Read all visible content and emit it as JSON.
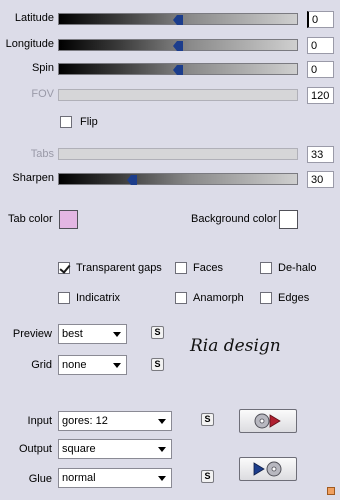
{
  "sliders": {
    "latitude": {
      "label": "Latitude",
      "value": "0",
      "position": 0.5
    },
    "longitude": {
      "label": "Longitude",
      "value": "0",
      "position": 0.5
    },
    "spin": {
      "label": "Spin",
      "value": "0",
      "position": 0.5
    },
    "fov": {
      "label": "FOV",
      "value": "120",
      "disabled": true
    },
    "tabs": {
      "label": "Tabs",
      "value": "33",
      "disabled": true
    },
    "sharpen": {
      "label": "Sharpen",
      "value": "30",
      "position": 0.3
    }
  },
  "flip": {
    "label": "Flip",
    "checked": false
  },
  "colors": {
    "tab_color_label": "Tab color",
    "tab_color": "#e3b6e3",
    "background_color_label": "Background color",
    "background_color": "#ffffff"
  },
  "options": {
    "transparent_gaps": {
      "label": "Transparent gaps",
      "checked": true
    },
    "faces": {
      "label": "Faces",
      "checked": false
    },
    "de_halo": {
      "label": "De-halo",
      "checked": false
    },
    "indicatrix": {
      "label": "Indicatrix",
      "checked": false
    },
    "anamorph": {
      "label": "Anamorph",
      "checked": false
    },
    "edges": {
      "label": "Edges",
      "checked": false
    }
  },
  "preview": {
    "label": "Preview",
    "value": "best"
  },
  "grid": {
    "label": "Grid",
    "value": "none"
  },
  "input": {
    "label": "Input",
    "value": "gores: 12"
  },
  "output": {
    "label": "Output",
    "value": "square"
  },
  "glue": {
    "label": "Glue",
    "value": "normal"
  },
  "small_button_label": "S",
  "brand_text": "Ria design",
  "icons": {
    "load": "cd-arrow-icon",
    "save": "arrow-cd-icon"
  }
}
